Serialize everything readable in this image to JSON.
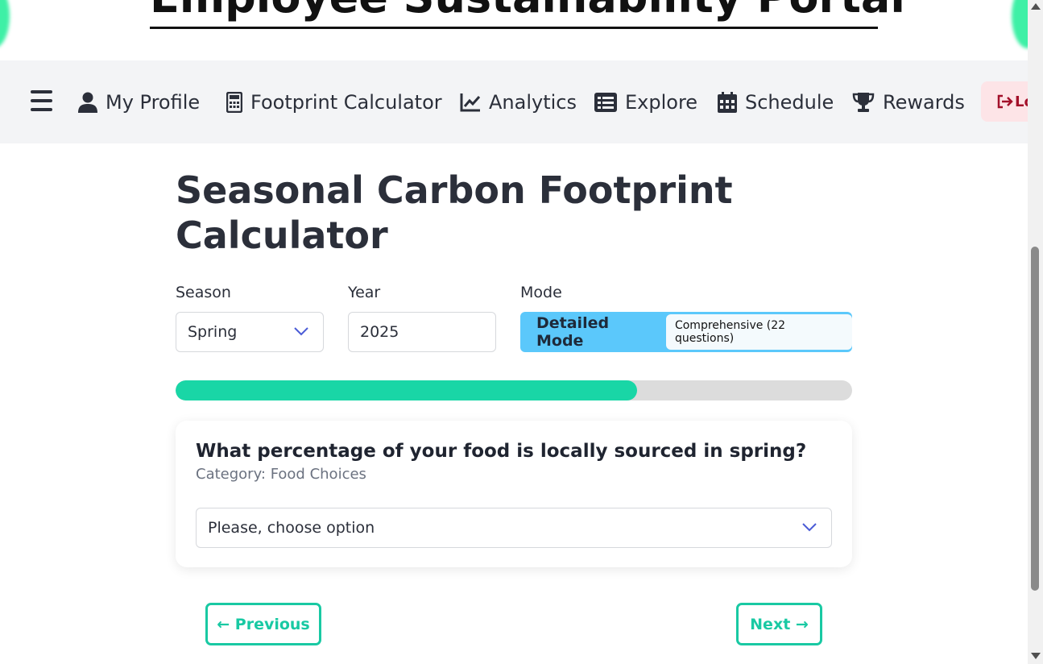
{
  "header": {
    "portal_title": "Employee Sustainability Portal"
  },
  "nav": {
    "items": [
      {
        "label": "My Profile",
        "icon": "user-icon"
      },
      {
        "label": "Footprint Calculator",
        "icon": "calculator-icon"
      },
      {
        "label": "Analytics",
        "icon": "chart-line-icon"
      },
      {
        "label": "Explore",
        "icon": "list-icon"
      },
      {
        "label": "Schedule",
        "icon": "calendar-icon"
      },
      {
        "label": "Rewards",
        "icon": "trophy-icon"
      }
    ],
    "logout_label": "Lo"
  },
  "main": {
    "title": "Seasonal Carbon Footprint Calculator",
    "season_label": "Season",
    "season_value": "Spring",
    "year_label": "Year",
    "year_value": "2025",
    "mode_label": "Mode",
    "mode_value": "Detailed Mode",
    "mode_badge": "Comprehensive (22 questions)",
    "progress_fraction": 0.682
  },
  "question": {
    "text": "What percentage of your food is locally sourced in spring?",
    "category": "Category: Food Choices",
    "answer_placeholder": "Please, choose option"
  },
  "buttons": {
    "previous": "← Previous",
    "next": "Next →"
  },
  "colors": {
    "accent": "#19c9a3",
    "progress": "#19d6a6",
    "mode_bg": "#5bc8fb",
    "nav_bg": "#f3f4f6",
    "logout_bg": "#fde4e7",
    "logout_text": "#a3102a"
  }
}
